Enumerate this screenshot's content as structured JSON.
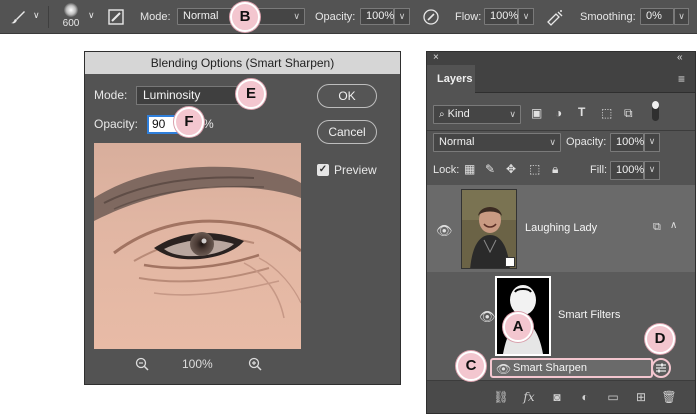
{
  "options_bar": {
    "brush_size": "600",
    "mode_label": "Mode:",
    "mode_value": "Normal",
    "opacity_label": "Opacity:",
    "opacity_value": "100%",
    "flow_label": "Flow:",
    "flow_value": "100%",
    "smoothing_label": "Smoothing:",
    "smoothing_value": "0%"
  },
  "dialog": {
    "title": "Blending Options (Smart Sharpen)",
    "mode_label": "Mode:",
    "mode_value": "Luminosity",
    "opacity_label": "Opacity:",
    "opacity_value": "90",
    "opacity_unit": "%",
    "ok_label": "OK",
    "cancel_label": "Cancel",
    "preview_label": "Preview",
    "preview_checked": true,
    "zoom_value": "100%"
  },
  "layers_panel": {
    "tab_label": "Layers",
    "filter_kind": "Kind",
    "blend_mode": "Normal",
    "opacity_label": "Opacity:",
    "opacity_value": "100%",
    "lock_label": "Lock:",
    "fill_label": "Fill:",
    "fill_value": "100%",
    "layer_name": "Laughing Lady",
    "smart_filters_label": "Smart Filters",
    "filter_name": "Smart Sharpen"
  },
  "callouts": {
    "a": "A",
    "b": "B",
    "c": "C",
    "d": "D",
    "e": "E",
    "f": "F"
  },
  "colors": {
    "ui_dark": "#535353",
    "callout_fill": "#f3c6cf",
    "focus_blue": "#2f7fdb"
  }
}
